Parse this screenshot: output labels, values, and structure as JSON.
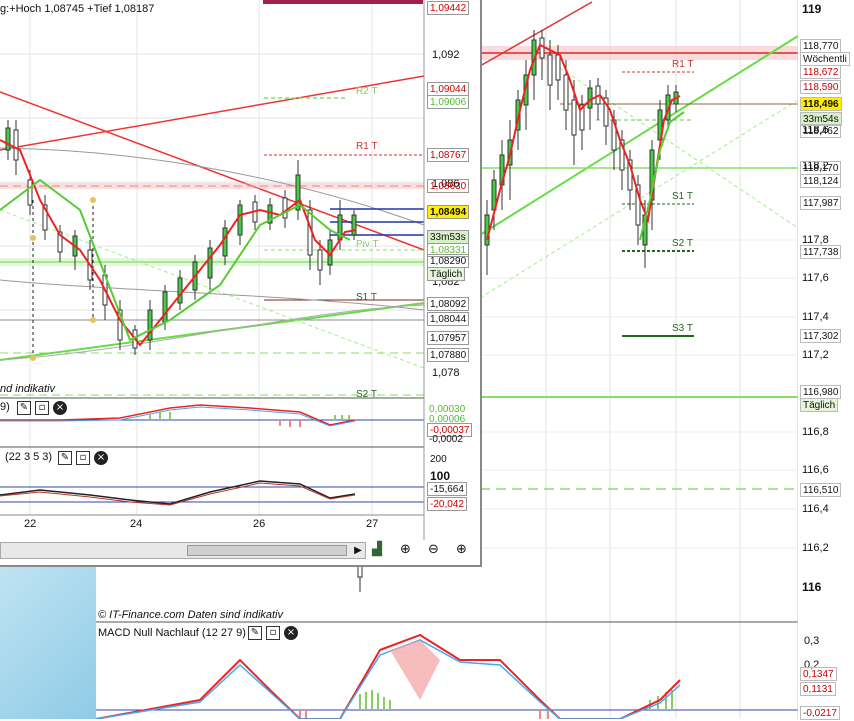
{
  "front": {
    "header_text": "g:+Hoch 1,08745 +Tief 1,08187",
    "data_note": "nd indikativ",
    "price_axis": [
      "1,092",
      "1,086",
      "1,082",
      "1,078"
    ],
    "date_axis": [
      "22",
      "24",
      "26",
      "27"
    ],
    "levels": {
      "r1": "R1 T",
      "r2": "R2 T",
      "piv": "Piv T",
      "s1": "S1 T",
      "s2": "S2 T"
    },
    "tags": [
      {
        "text": "1,09442",
        "color": "#cc0000",
        "bg": "#fff"
      },
      {
        "text": "1,09044",
        "color": "#cc0000",
        "bg": "#fff"
      },
      {
        "text": "1,09006",
        "color": "#55bb33",
        "bg": "#fff"
      },
      {
        "text": "1,08767",
        "color": "#cc0000",
        "bg": "#fff"
      },
      {
        "text": "1,08630",
        "color": "#cc0000",
        "bg": "#fff"
      },
      {
        "text": "1,08494",
        "color": "#000",
        "bg": "#ffee00"
      },
      {
        "text": "33m53s",
        "color": "#000",
        "bg": "#d8f0c8"
      },
      {
        "text": "1,08331",
        "color": "#55bb33",
        "bg": "#fff"
      },
      {
        "text": "1,08290",
        "color": "#000",
        "bg": "#fff"
      },
      {
        "text": "Täglich",
        "color": "#000",
        "bg": "#e4f5dc"
      },
      {
        "text": "1,08092",
        "color": "#000",
        "bg": "#fff"
      },
      {
        "text": "1,08044",
        "color": "#000",
        "bg": "#fff"
      },
      {
        "text": "1,07957",
        "color": "#000",
        "bg": "#fff"
      },
      {
        "text": "1,07880",
        "color": "#000",
        "bg": "#fff"
      }
    ],
    "macd": {
      "label": "9)",
      "tags": [
        "0,00030",
        "0,00006",
        "-0,00037",
        "-0,0002"
      ]
    },
    "osc": {
      "label": "(22 3 5 3)",
      "axis": [
        "200",
        "100"
      ],
      "tags": [
        "-15,664",
        "-20,042"
      ]
    }
  },
  "back": {
    "price_axis": [
      "119",
      "118,6",
      "118,2",
      "117,8",
      "117,6",
      "117,4",
      "117,2",
      "116,8",
      "116,6",
      "116,4",
      "116,2",
      "116"
    ],
    "levels": {
      "r1": "R1 T",
      "s1": "S1 T",
      "s2": "S2 T",
      "s3": "S3 T"
    },
    "tags": [
      {
        "text": "118,770",
        "color": "#000",
        "bg": "#fff"
      },
      {
        "text": "Wöchentli",
        "color": "#000",
        "bg": "#fff"
      },
      {
        "text": "118,672",
        "color": "#cc0000",
        "bg": "#fff"
      },
      {
        "text": "118,590",
        "color": "#cc0000",
        "bg": "#fff"
      },
      {
        "text": "118,496",
        "color": "#000",
        "bg": "#ffee00"
      },
      {
        "text": "33m54s",
        "color": "#000",
        "bg": "#d8f0c8"
      },
      {
        "text": "118,462",
        "color": "#000",
        "bg": "#fff"
      },
      {
        "text": "118,170",
        "color": "#000",
        "bg": "#fff"
      },
      {
        "text": "118,124",
        "color": "#000",
        "bg": "#fff"
      },
      {
        "text": "117,987",
        "color": "#000",
        "bg": "#fff"
      },
      {
        "text": "117,738",
        "color": "#000",
        "bg": "#fff"
      },
      {
        "text": "117,302",
        "color": "#000",
        "bg": "#fff"
      },
      {
        "text": "116,980",
        "color": "#000",
        "bg": "#fff"
      },
      {
        "text": "Täglich",
        "color": "#000",
        "bg": "#e4f5dc"
      },
      {
        "text": "116,510",
        "color": "#000",
        "bg": "#fff"
      }
    ],
    "footer": "© IT-Finance.com  Daten sind indikativ",
    "macd": {
      "label": "MACD Null Nachlauf (12 27 9)",
      "axis": [
        "0,3",
        "0,2"
      ],
      "tags": [
        "0,1347",
        "0,1131",
        "-0,0217"
      ]
    }
  },
  "icons": [
    "wrench-icon",
    "window-icon",
    "close-icon",
    "chart-type-icon",
    "zoom-fit-icon",
    "zoom-out-icon",
    "zoom-in-icon"
  ]
}
